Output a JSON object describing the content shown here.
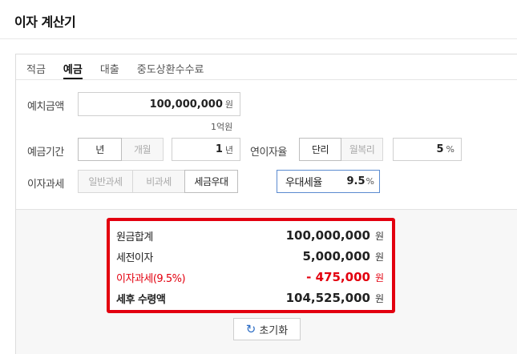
{
  "title": "이자 계산기",
  "tabs": [
    {
      "label": "적금",
      "active": false
    },
    {
      "label": "예금",
      "active": true
    },
    {
      "label": "대출",
      "active": false
    },
    {
      "label": "중도상환수수료",
      "active": false
    }
  ],
  "deposit": {
    "label": "예치금액",
    "value": "100,000,000",
    "unit": "원",
    "hint": "1억원"
  },
  "period": {
    "label": "예금기간",
    "options": [
      "년",
      "개월"
    ],
    "selected": "년",
    "value": "1",
    "unit": "년"
  },
  "rate": {
    "label": "연이자율",
    "options": [
      "단리",
      "월복리"
    ],
    "selected": "단리",
    "value": "5",
    "unit": "%"
  },
  "tax": {
    "label": "이자과세",
    "options": [
      "일반과세",
      "비과세",
      "세금우대"
    ],
    "selected": "세금우대",
    "pref_label": "우대세율",
    "pref_value": "9.5",
    "pref_unit": "%"
  },
  "result": {
    "principal_label": "원금합계",
    "principal_value": "100,000,000",
    "interest_label": "세전이자",
    "interest_value": "5,000,000",
    "tax_label": "이자과세(9.5%)",
    "tax_value": "- 475,000",
    "net_label": "세후 수령액",
    "net_value": "104,525,000",
    "unit": "원"
  },
  "reset_label": "초기화",
  "colors": {
    "highlight": "#e3000f",
    "accent_blue": "#2b6cc4"
  }
}
